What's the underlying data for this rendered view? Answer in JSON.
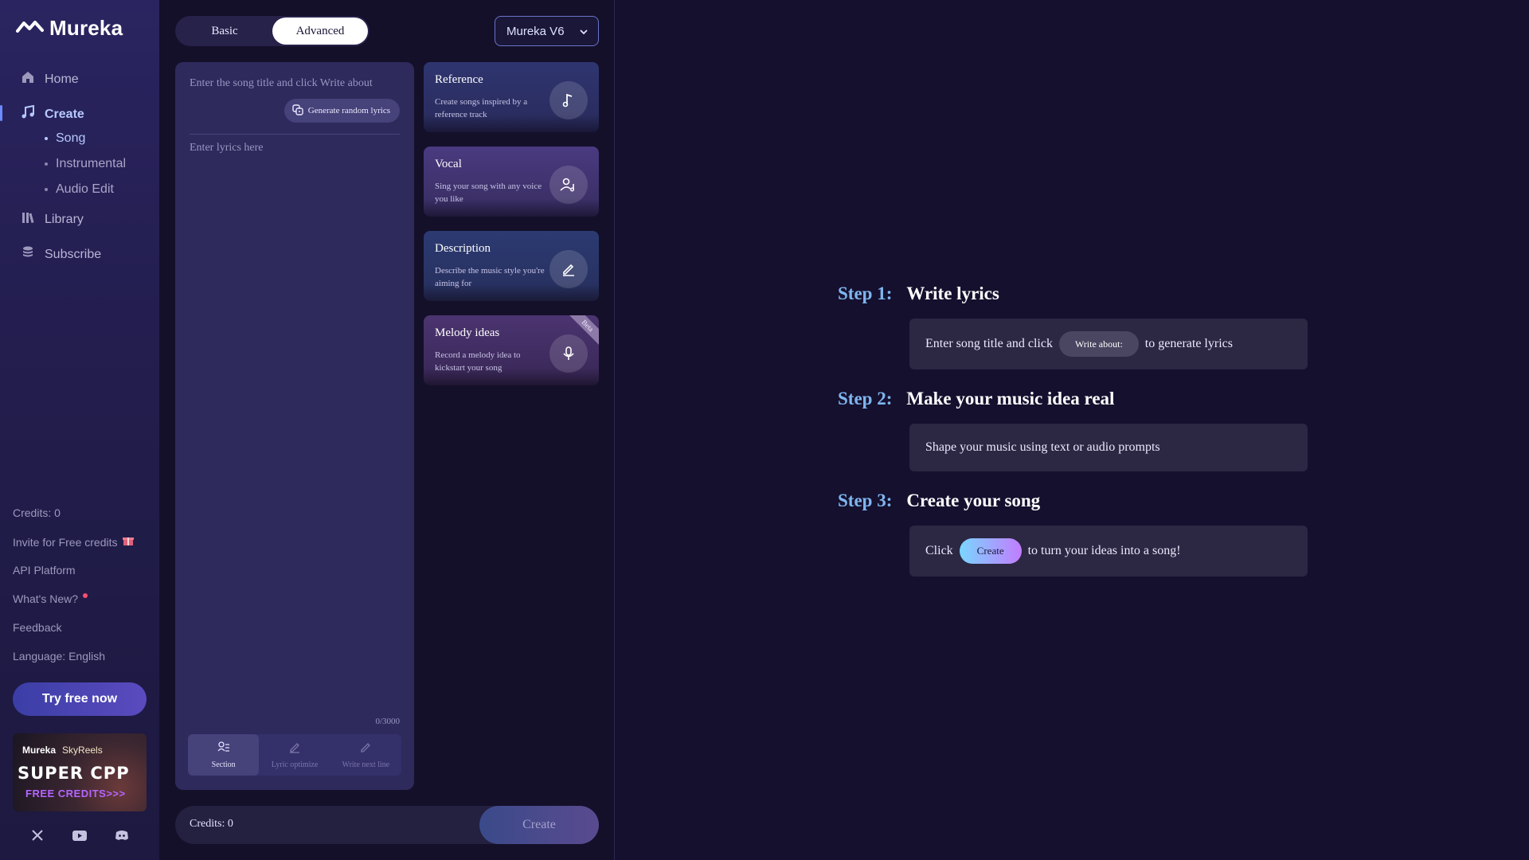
{
  "app": {
    "name": "Mureka"
  },
  "sidebar": {
    "nav": [
      {
        "label": "Home",
        "icon": "home-icon"
      },
      {
        "label": "Create",
        "icon": "music-note-icon",
        "active": true
      },
      {
        "label": "Library",
        "icon": "library-icon"
      },
      {
        "label": "Subscribe",
        "icon": "coins-icon"
      }
    ],
    "create_sub": [
      {
        "label": "Song",
        "active": true
      },
      {
        "label": "Instrumental"
      },
      {
        "label": "Audio Edit"
      }
    ],
    "links": {
      "credits": "Credits: 0",
      "invite": "Invite for Free credits",
      "api": "API Platform",
      "whats_new": "What's New?",
      "feedback": "Feedback",
      "language": "Language: English"
    },
    "try_button": "Try free now",
    "promo": {
      "brand1": "Mureka",
      "brand2": "SkyReels",
      "headline": "SUPER CPP",
      "subline": "FREE CREDITS>>>"
    },
    "socials": [
      "x-icon",
      "youtube-icon",
      "discord-icon"
    ]
  },
  "editor": {
    "tabs": {
      "basic": "Basic",
      "advanced": "Advanced",
      "selected": "Advanced"
    },
    "model": "Mureka V6",
    "title_placeholder": "Enter the song title and click Write about",
    "generate_label": "Generate random lyrics",
    "lyrics_placeholder": "Enter lyrics here",
    "counter": "0/3000",
    "tools": [
      {
        "label": "Section",
        "active": true
      },
      {
        "label": "Lyric optimize"
      },
      {
        "label": "Write next line"
      }
    ],
    "cards": [
      {
        "title": "Reference",
        "desc": "Create songs inspired by a reference track",
        "icon": "music-note-icon"
      },
      {
        "title": "Vocal",
        "desc": "Sing your song with any voice you like",
        "icon": "voice-user-icon"
      },
      {
        "title": "Description",
        "desc": "Describe the music style you're aiming for",
        "icon": "pen-icon"
      },
      {
        "title": "Melody ideas",
        "desc": "Record a melody idea to kickstart your song",
        "icon": "microphone-icon",
        "badge": "Beta"
      }
    ],
    "credits": "Credits: 0",
    "create_label": "Create"
  },
  "guide": {
    "steps": [
      {
        "num": "Step 1:",
        "title": "Write lyrics",
        "pre": "Enter song title and click",
        "pill": "Write about:",
        "post": "to generate lyrics"
      },
      {
        "num": "Step 2:",
        "title": "Make your music idea real",
        "text": "Shape your music using text or audio prompts"
      },
      {
        "num": "Step 3:",
        "title": "Create your song",
        "pre": "Click",
        "pill": "Create",
        "post": "to turn your ideas into a song!"
      }
    ]
  },
  "colors": {
    "accent": "#7fb6f0",
    "nav_active": "#b6c9ff",
    "sidebar_bg": "#2a2460",
    "page_bg": "#15102e"
  }
}
